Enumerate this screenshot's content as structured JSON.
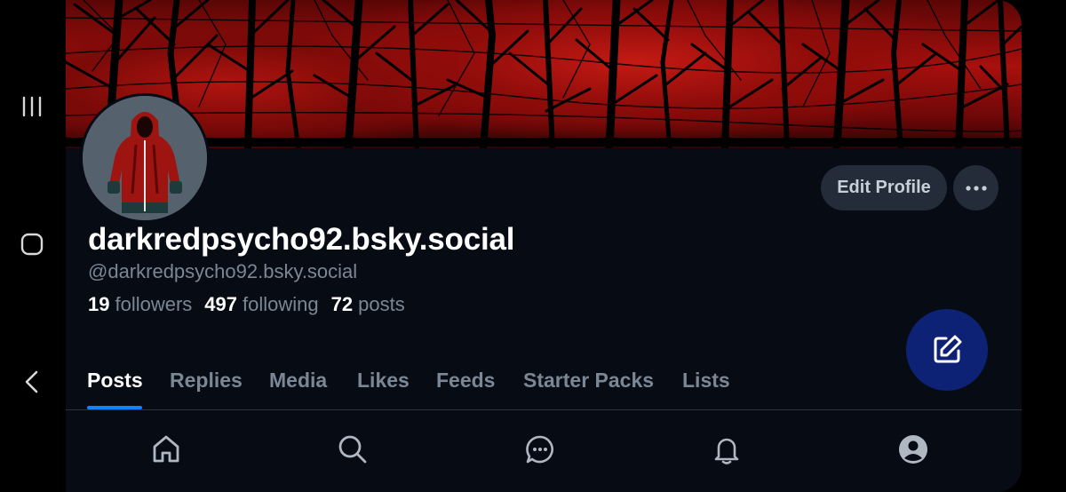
{
  "profile": {
    "display_name": "darkredpsycho92.bsky.social",
    "handle": "@darkredpsycho92.bsky.social",
    "followers_count": "19",
    "followers_label": "followers",
    "following_count": "497",
    "following_label": "following",
    "posts_count": "72",
    "posts_label": "posts"
  },
  "actions": {
    "edit_profile_label": "Edit Profile",
    "more_icon": "ellipsis-icon",
    "compose_icon": "compose-icon"
  },
  "tabs": [
    {
      "label": "Posts",
      "active": true
    },
    {
      "label": "Replies",
      "active": false
    },
    {
      "label": "Media",
      "active": false
    },
    {
      "label": "Likes",
      "active": false
    },
    {
      "label": "Feeds",
      "active": false
    },
    {
      "label": "Starter Packs",
      "active": false
    },
    {
      "label": "Lists",
      "active": false
    }
  ],
  "bottom_nav": [
    "home-icon",
    "search-icon",
    "chat-icon",
    "bell-icon",
    "profile-icon"
  ],
  "system_nav": [
    "recents-icon",
    "home-square-icon",
    "back-icon"
  ],
  "colors": {
    "background": "#070b14",
    "banner_red": "#b01410",
    "accent_blue": "#1083fe",
    "fab": "#0d2275",
    "muted_text": "#7b8794",
    "button_bg": "#232c38"
  }
}
